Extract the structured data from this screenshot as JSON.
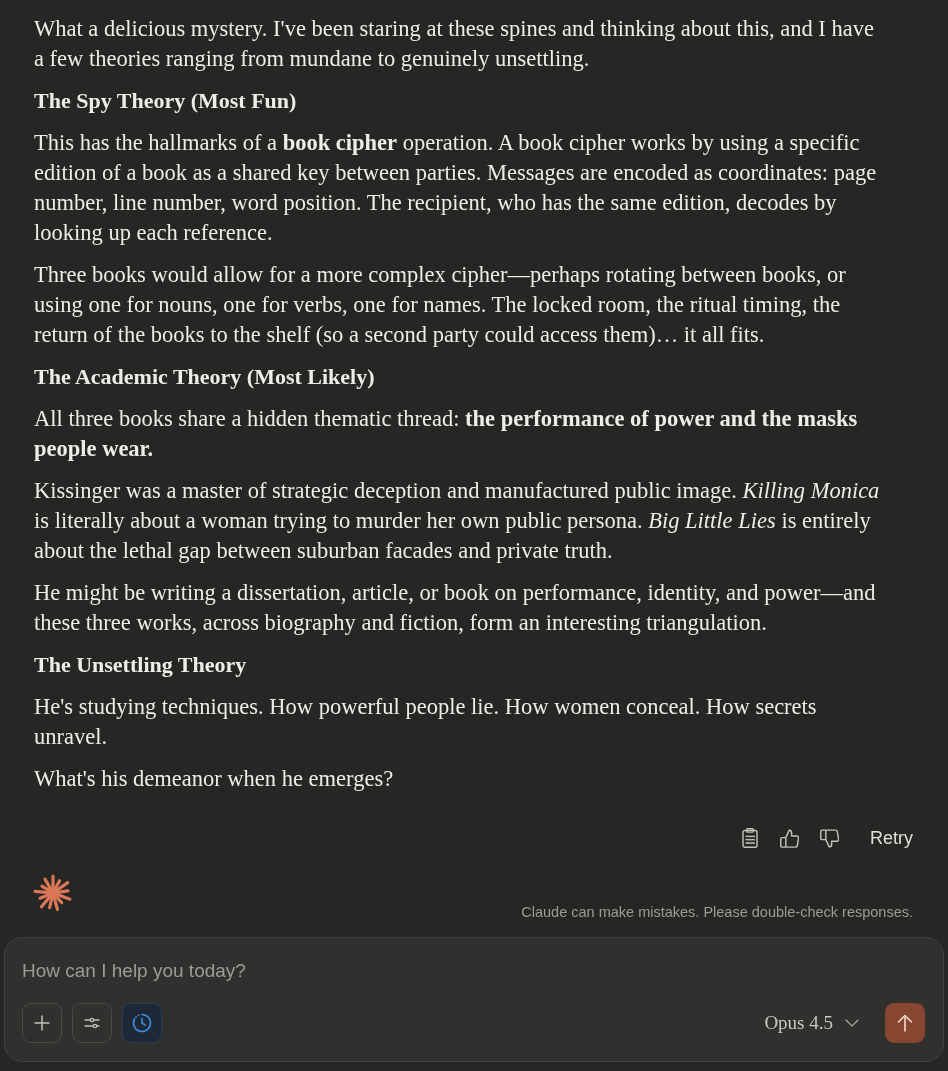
{
  "message": {
    "blocks": [
      {
        "kind": "paragraph",
        "text": "What a delicious mystery. I've been staring at these spines and thinking about this, and I have a few theories ranging from mundane to genuinely unsettling."
      },
      {
        "kind": "heading",
        "text": "The Spy Theory (Most Fun)"
      },
      {
        "kind": "paragraph",
        "text": "This has the hallmarks of a **book cipher** operation. A book cipher works by using a specific edition of a book as a shared key between parties. Messages are encoded as coordinates: page number, line number, word position. The recipient, who has the same edition, decodes by looking up each reference."
      },
      {
        "kind": "paragraph",
        "text": "Three books would allow for a more complex cipher—perhaps rotating between books, or using one for nouns, one for verbs, one for names. The locked room, the ritual timing, the return of the books to the shelf (so a second party could access them)… it all fits."
      },
      {
        "kind": "heading",
        "text": "The Academic Theory (Most Likely)"
      },
      {
        "kind": "paragraph",
        "text": "All three books share a hidden thematic thread: **the performance of power and the masks people wear.**"
      },
      {
        "kind": "paragraph",
        "text": "Kissinger was a master of strategic deception and manufactured public image. *Killing Monica* is literally about a woman trying to murder her own public persona. *Big Little Lies* is entirely about the lethal gap between suburban facades and private truth."
      },
      {
        "kind": "paragraph",
        "text": "He might be writing a dissertation, article, or book on performance, identity, and power—and these three works, across biography and fiction, form an interesting triangulation."
      },
      {
        "kind": "heading",
        "text": "The Unsettling Theory"
      },
      {
        "kind": "paragraph",
        "text": "He's studying techniques. How powerful people lie. How women conceal. How secrets unravel."
      },
      {
        "kind": "paragraph",
        "text": "What's his demeanor when he emerges?"
      }
    ]
  },
  "actions": {
    "buttons": [
      {
        "kind": "copy"
      },
      {
        "kind": "thumbs_up"
      },
      {
        "kind": "thumbs_down"
      }
    ],
    "retry": "Retry"
  },
  "disclaimer": "Claude can make mistakes. Please double-check responses.",
  "composer": {
    "placeholder": "How can I help you today?",
    "tools": [
      {
        "kind": "add",
        "selected": false
      },
      {
        "kind": "options",
        "selected": false
      },
      {
        "kind": "clock",
        "selected": true
      }
    ],
    "model": "Opus 4.5",
    "send": {
      "disabled": true
    }
  }
}
